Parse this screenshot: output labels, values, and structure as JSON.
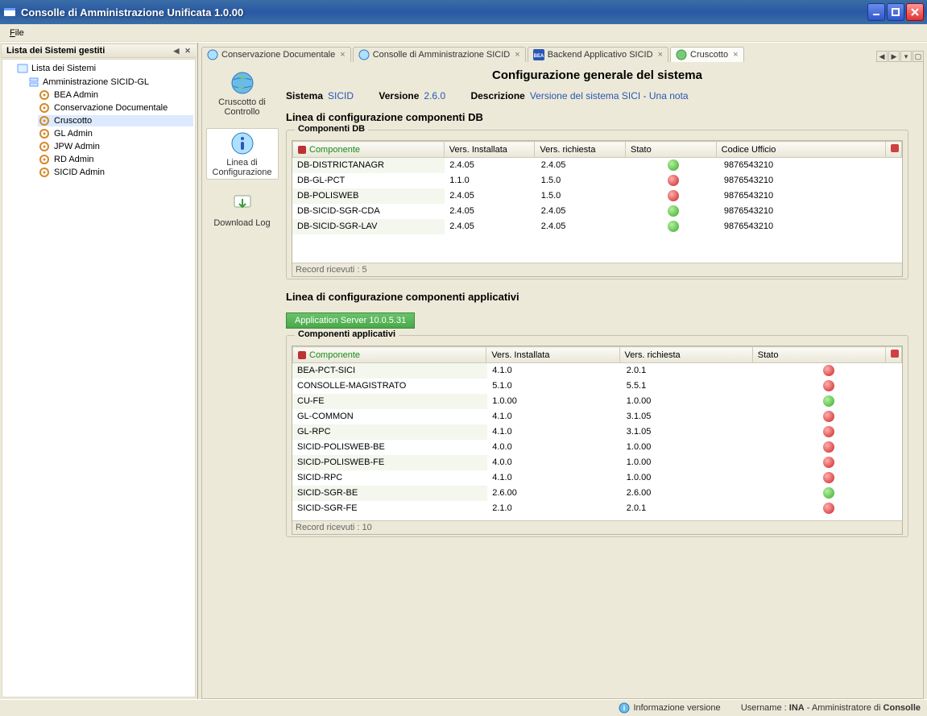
{
  "window": {
    "title": "Consolle di Amministrazione Unificata 1.0.00"
  },
  "menubar": {
    "file": "File"
  },
  "sidebar": {
    "title": "Lista dei Sistemi gestiti",
    "root": "Lista dei Sistemi",
    "group": "Amministrazione SICID-GL",
    "items": [
      "BEA Admin",
      "Conservazione Documentale",
      "Cruscotto",
      "GL Admin",
      "JPW Admin",
      "RD Admin",
      "SICID Admin"
    ],
    "selected": "Cruscotto"
  },
  "tabs": [
    {
      "label": "Conservazione Documentale",
      "icon": "doc",
      "active": false
    },
    {
      "label": "Consolle di Amministrazione SICID",
      "icon": "globe",
      "active": false
    },
    {
      "label": "Backend Applicativo SICID",
      "icon": "bea",
      "active": false
    },
    {
      "label": "Cruscotto",
      "icon": "globe-green",
      "active": true
    }
  ],
  "toolcol": {
    "cruscotto": "Cruscotto di Controllo",
    "linea": "Linea di Configurazione",
    "download": "Download Log"
  },
  "page": {
    "title": "Configurazione generale del sistema",
    "kv": {
      "sistema_lbl": "Sistema",
      "sistema_val": "SICID",
      "versione_lbl": "Versione",
      "versione_val": "2.6.0",
      "descr_lbl": "Descrizione",
      "descr_val": "Versione del sistema SICI - Una nota"
    },
    "section_db_title": "Linea di configurazione componenti DB",
    "group_db_legend": "Componenti DB",
    "db_headers": {
      "componente": "Componente",
      "vers_inst": "Vers. Installata",
      "vers_rich": "Vers. richiesta",
      "stato": "Stato",
      "codice": "Codice Ufficio"
    },
    "db_rows": [
      {
        "c": "DB-DISTRICTANAGR",
        "vi": "2.4.05",
        "vr": "2.4.05",
        "s": "ok",
        "cu": "9876543210"
      },
      {
        "c": "DB-GL-PCT",
        "vi": "1.1.0",
        "vr": "1.5.0",
        "s": "err",
        "cu": "9876543210"
      },
      {
        "c": "DB-POLISWEB",
        "vi": "2.4.05",
        "vr": "1.5.0",
        "s": "err",
        "cu": "9876543210"
      },
      {
        "c": "DB-SICID-SGR-CDA",
        "vi": "2.4.05",
        "vr": "2.4.05",
        "s": "ok",
        "cu": "9876543210"
      },
      {
        "c": "DB-SICID-SGR-LAV",
        "vi": "2.4.05",
        "vr": "2.4.05",
        "s": "ok",
        "cu": "9876543210"
      }
    ],
    "db_record": "Record ricevuti : 5",
    "section_app_title": "Linea di configurazione componenti applicativi",
    "appserver_btn": "Application Server 10.0.5.31",
    "group_app_legend": "Componenti applicativi",
    "app_headers": {
      "componente": "Componente",
      "vers_inst": "Vers. Installata",
      "vers_rich": "Vers. richiesta",
      "stato": "Stato"
    },
    "app_rows": [
      {
        "c": "BEA-PCT-SICI",
        "vi": "4.1.0",
        "vr": "2.0.1",
        "s": "err"
      },
      {
        "c": "CONSOLLE-MAGISTRATO",
        "vi": "5.1.0",
        "vr": "5.5.1",
        "s": "err"
      },
      {
        "c": "CU-FE",
        "vi": "1.0.00",
        "vr": "1.0.00",
        "s": "ok"
      },
      {
        "c": "GL-COMMON",
        "vi": "4.1.0",
        "vr": "3.1.05",
        "s": "err"
      },
      {
        "c": "GL-RPC",
        "vi": "4.1.0",
        "vr": "3.1.05",
        "s": "err"
      },
      {
        "c": "SICID-POLISWEB-BE",
        "vi": "4.0.0",
        "vr": "1.0.00",
        "s": "err"
      },
      {
        "c": "SICID-POLISWEB-FE",
        "vi": "4.0.0",
        "vr": "1.0.00",
        "s": "err"
      },
      {
        "c": "SICID-RPC",
        "vi": "4.1.0",
        "vr": "1.0.00",
        "s": "err"
      },
      {
        "c": "SICID-SGR-BE",
        "vi": "2.6.00",
        "vr": "2.6.00",
        "s": "ok"
      },
      {
        "c": "SICID-SGR-FE",
        "vi": "2.1.0",
        "vr": "2.0.1",
        "s": "err"
      }
    ],
    "app_record": "Record ricevuti : 10"
  },
  "statusbar": {
    "info": "Informazione versione",
    "username_lbl": "Username :",
    "username_val": "INA",
    "role": "- Amministratore di",
    "app": "Consolle"
  }
}
